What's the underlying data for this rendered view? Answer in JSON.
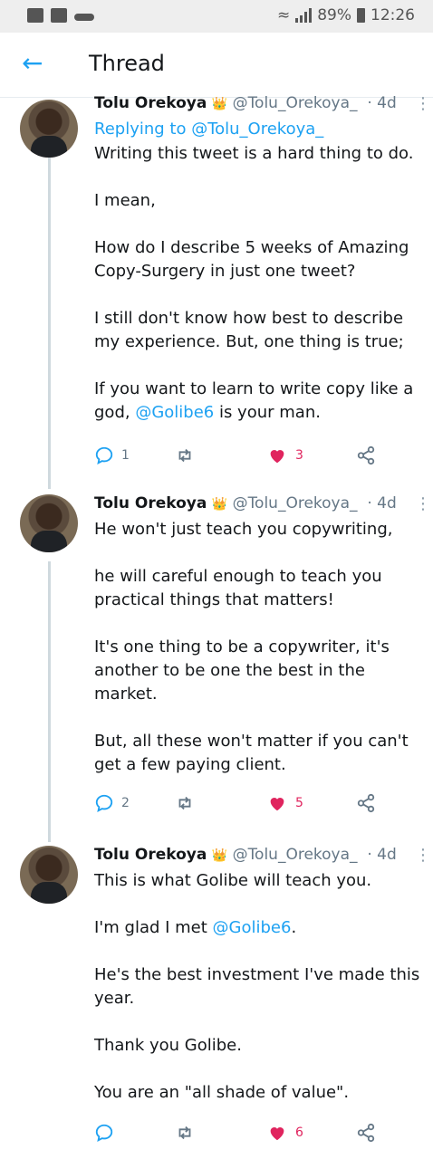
{
  "status_bar": {
    "battery": "89%",
    "time": "12:26"
  },
  "header": {
    "title": "Thread"
  },
  "tweets": [
    {
      "name": "Tolu Orekoya",
      "handle": "@Tolu_Orekoya_",
      "age": "4d",
      "replying_prefix": "Replying to ",
      "replying_to": "@Tolu_Orekoya_",
      "paragraphs": [
        "Writing this tweet is a hard thing to do.",
        "I mean,",
        "How do I describe 5 weeks of Amazing Copy-Surgery in just one tweet?",
        "I still don't know how best to describe my experience. But, one thing is true;"
      ],
      "last_pre": "If you want to learn to write copy like a god, ",
      "last_mention": "@Golibe6",
      "last_post": " is your man.",
      "replies": "1",
      "retweets": "",
      "likes": "3"
    },
    {
      "name": "Tolu Orekoya",
      "handle": "@Tolu_Orekoya_",
      "age": "4d",
      "paragraphs": [
        "He won't  just teach you copywriting,",
        "he will careful enough to teach you practical things that matters!",
        "It's one thing to be a copywriter, it's another to be one the best in the market.",
        "But, all these won't matter if you can't get a few paying client."
      ],
      "replies": "2",
      "retweets": "",
      "likes": "5"
    },
    {
      "name": "Tolu Orekoya",
      "handle": "@Tolu_Orekoya_",
      "age": "4d",
      "p1": "This is what Golibe will teach you.",
      "p2_pre": "I'm glad I met ",
      "p2_mention": "@Golibe6",
      "p2_post": ".",
      "p3": "He's the best investment I've made this year.",
      "p4": "Thank you Golibe.",
      "p5": "You are an \"all shade of value\".",
      "replies": "",
      "retweets": "",
      "likes": "6"
    }
  ],
  "colors": {
    "accent": "#1da1f2",
    "like": "#e0245e",
    "muted": "#657786"
  }
}
